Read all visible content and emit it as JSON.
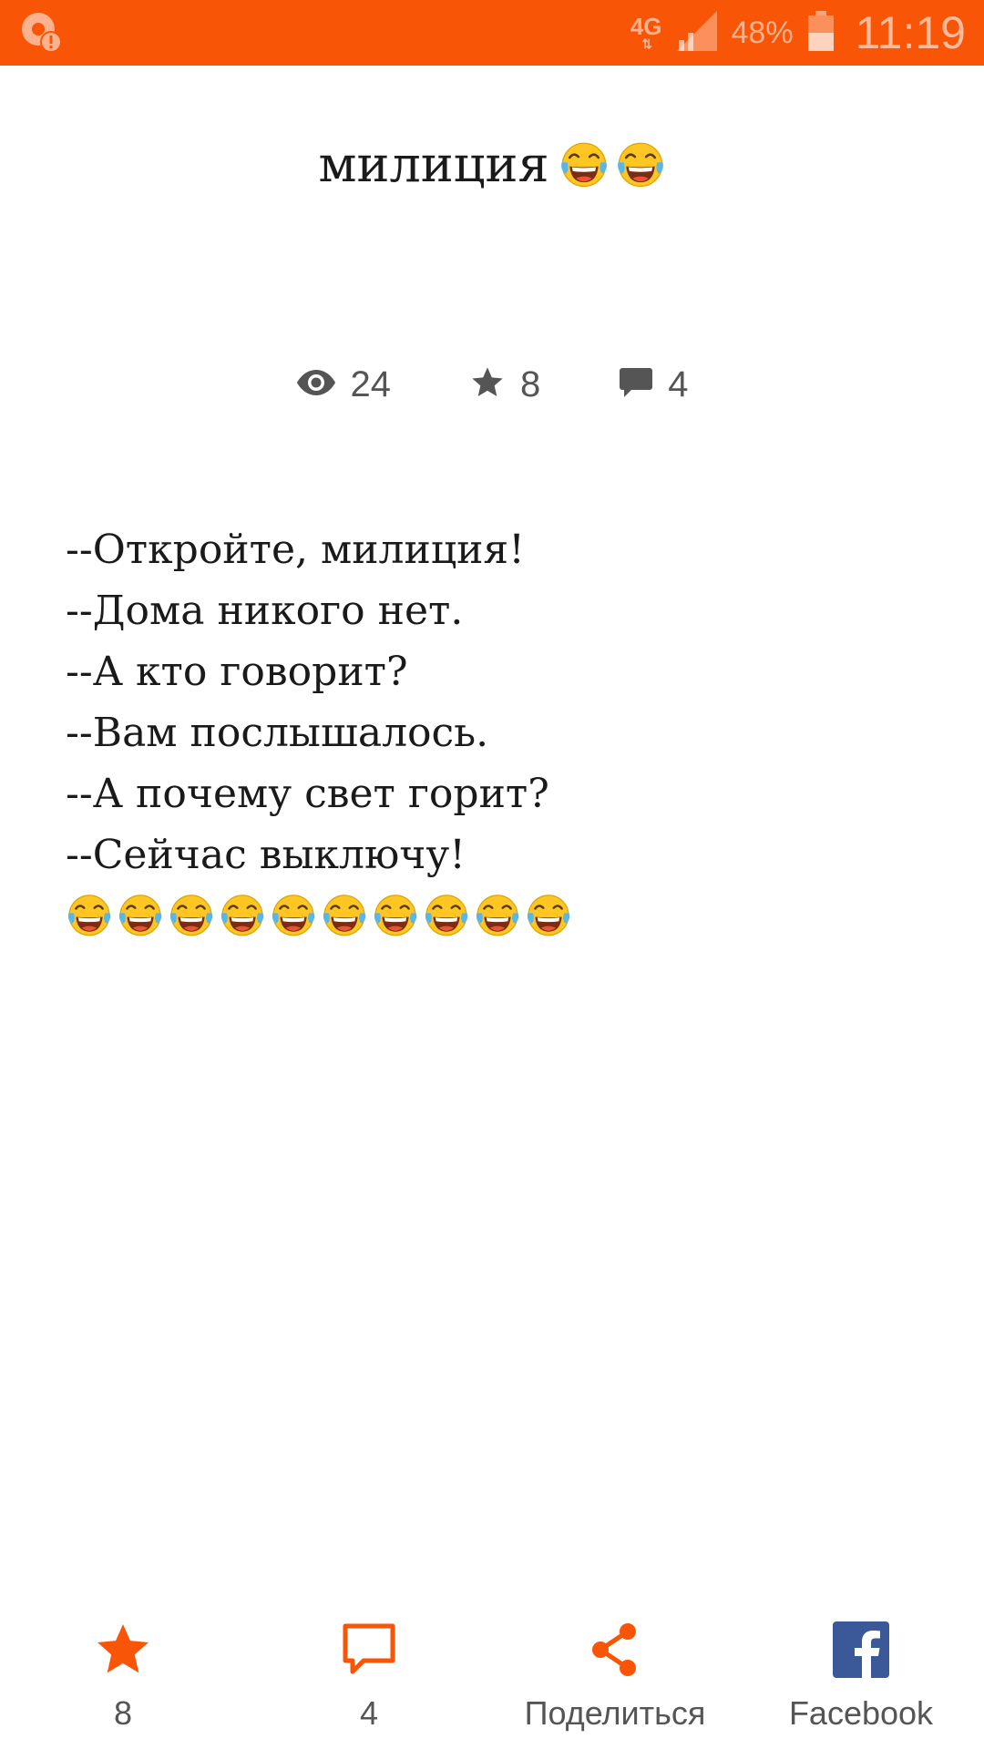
{
  "status_bar": {
    "network_type": "4G",
    "battery_percent": "48%",
    "time": "11:19"
  },
  "post": {
    "title": "милиция",
    "title_emoji_count": 2,
    "stats": {
      "views": "24",
      "stars": "8",
      "comments": "4"
    },
    "lines": [
      "--Откройте, милиция!",
      "--Дома никого нет.",
      "--А кто говорит?",
      "--Вам послышалось.",
      "--А почему свет горит?",
      "--Сейчас выключу!"
    ],
    "trailing_emoji_count": 10
  },
  "bottom_bar": {
    "star_count": "8",
    "comment_count": "4",
    "share_label": "Поделиться",
    "facebook_label": "Facebook"
  },
  "colors": {
    "accent": "#f95506",
    "icon_gray": "#555555",
    "facebook": "#3b5998"
  },
  "icons": {
    "status_left": "app-notification-icon",
    "views": "eye-icon",
    "stars": "star-icon",
    "comments": "comment-icon",
    "emoji": "face-with-tears-of-joy-emoji",
    "share": "share-icon",
    "facebook": "facebook-icon"
  }
}
